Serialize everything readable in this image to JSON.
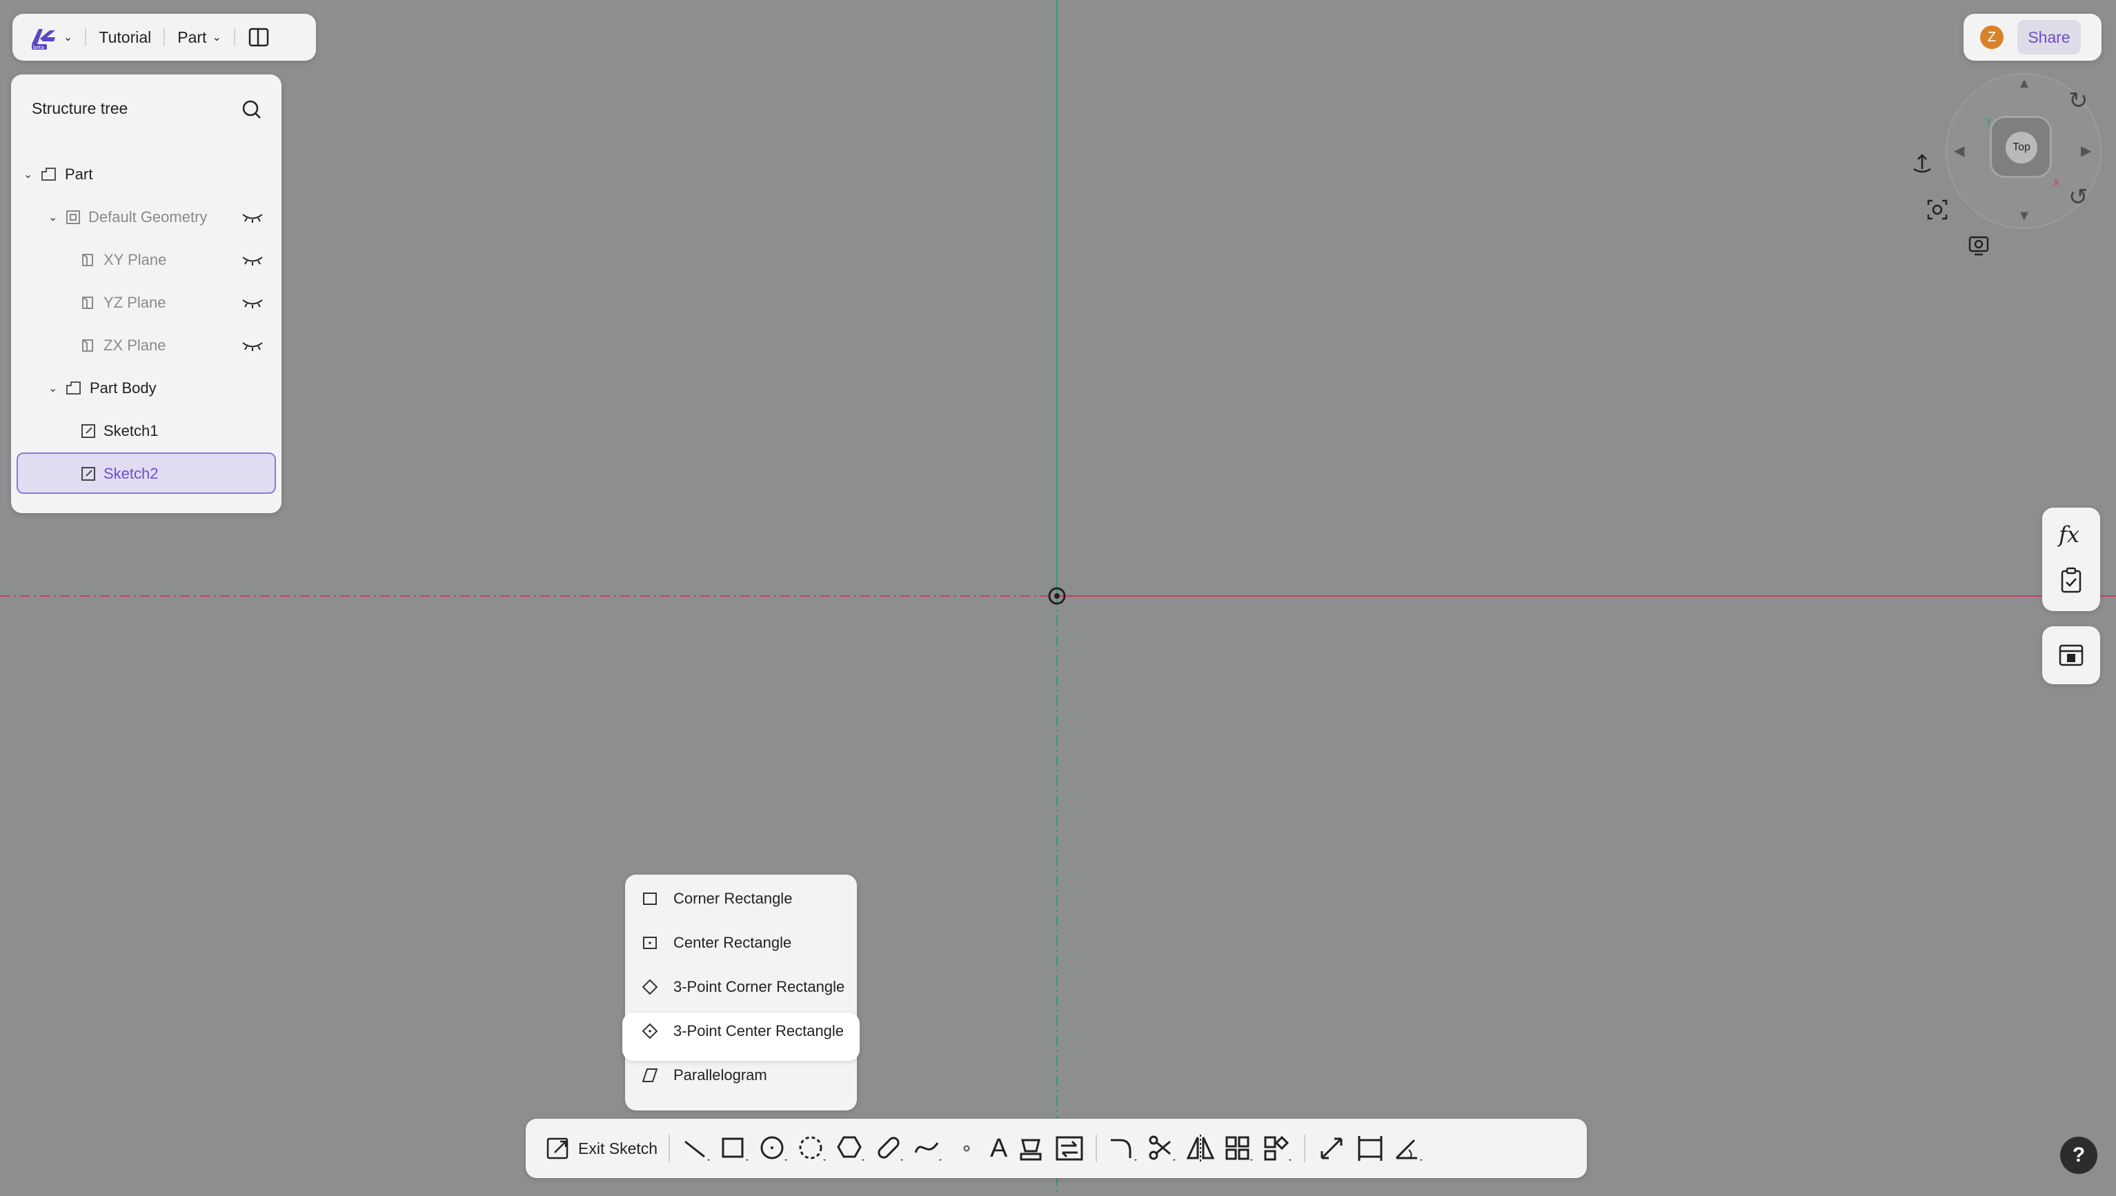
{
  "app": {
    "logo_label": "beta"
  },
  "topbar": {
    "document_name": "Tutorial",
    "mode_menu": "Part"
  },
  "structure_tree": {
    "title": "Structure tree",
    "items": [
      {
        "label": "Part",
        "level": 0
      },
      {
        "label": "Default Geometry",
        "level": 1
      },
      {
        "label": "XY Plane",
        "level": 2
      },
      {
        "label": "YZ Plane",
        "level": 2
      },
      {
        "label": "ZX Plane",
        "level": 2
      },
      {
        "label": "Part Body",
        "level": 1
      },
      {
        "label": "Sketch1",
        "level": 2
      },
      {
        "label": "Sketch2",
        "level": 2,
        "selected": true
      }
    ]
  },
  "user": {
    "avatar_letter": "Z",
    "share_label": "Share"
  },
  "viewcube": {
    "face_label": "Top",
    "axis_y": "Y",
    "axis_x": "X"
  },
  "side_tools": {
    "formula_label": "fx"
  },
  "rectangle_menu": {
    "items": [
      {
        "label": "Corner Rectangle"
      },
      {
        "label": "Center Rectangle"
      },
      {
        "label": "3-Point Corner Rectangle"
      },
      {
        "label": "3-Point Center Rectangle",
        "highlighted": true
      },
      {
        "label": "Parallelogram"
      }
    ]
  },
  "toolbar": {
    "exit_sketch_label": "Exit Sketch",
    "text_tool_glyph": "A"
  },
  "help": {
    "label": "?"
  },
  "colors": {
    "canvas": "#8d8e8f",
    "accent": "#6a4fc8",
    "x_axis": "#d33a55",
    "y_axis": "#2e9e77"
  }
}
